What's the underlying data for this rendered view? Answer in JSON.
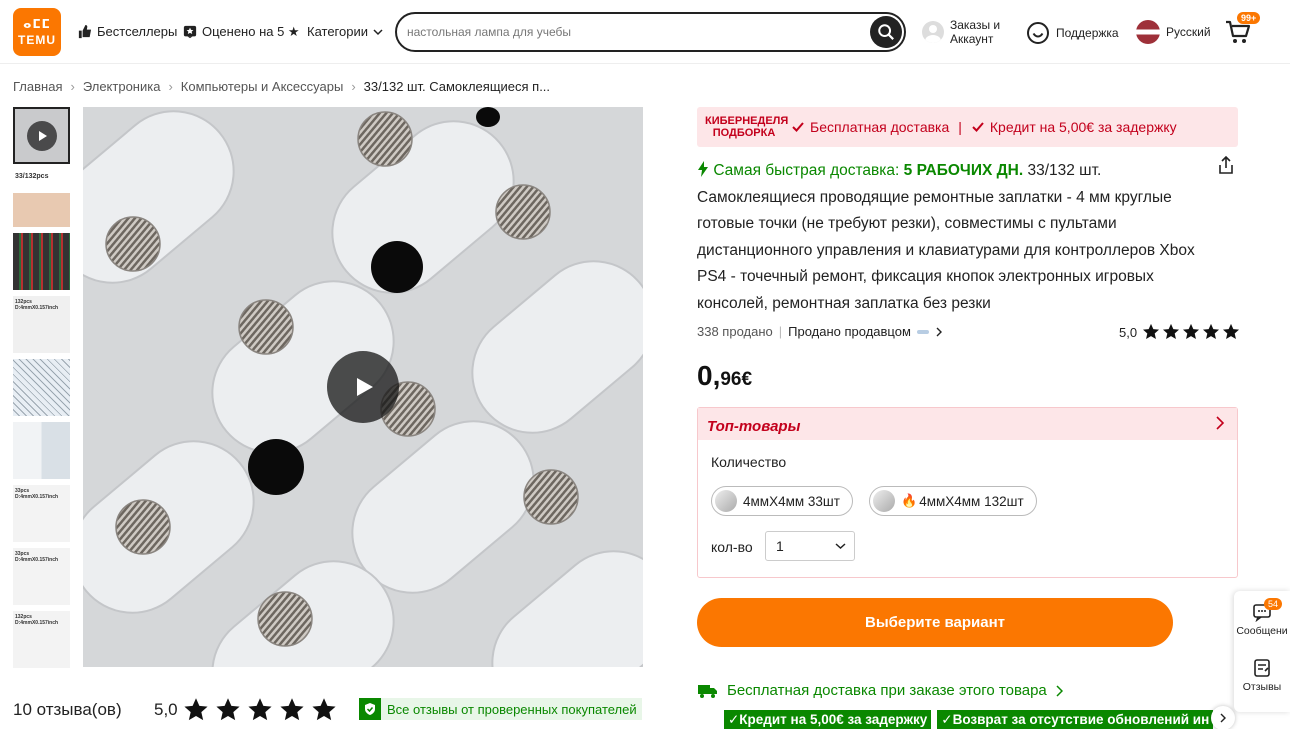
{
  "header": {
    "logo_top": "ⴰⵎⵎ",
    "logo_text": "TEMU",
    "bestsellers": "Бестселлеры",
    "rated5": "Оценено на 5 ★",
    "categories": "Категории",
    "search_placeholder": "настольная лампа для учебы",
    "account_line1": "Заказы и",
    "account_line2": "Аккаунт",
    "support": "Поддержка",
    "language": "Русский",
    "cart_count": "99+"
  },
  "breadcrumb": [
    "Главная",
    "Электроника",
    "Компьютеры и Аксессуары",
    "33/132 шт. Самоклеящиеся п..."
  ],
  "thumbnails": [
    {
      "label": ""
    },
    {
      "label": "33/132pcs"
    },
    {
      "label": ""
    },
    {
      "label": "132pcs D:4mmX0.157inch"
    },
    {
      "label": ""
    },
    {
      "label": ""
    },
    {
      "label": "33pcs D:4mmX0.157inch"
    },
    {
      "label": "33pcs D:4mmX0.157inch"
    },
    {
      "label": "132pcs D:4mmX0.157inch"
    }
  ],
  "promo": {
    "tag": "КИБЕРНЕДЕЛЯ ПОДБОРКА",
    "free_shipping": "Бесплатная доставка",
    "credit": "Кредит на 5,00€ за задержку"
  },
  "product": {
    "fast_prefix": "Самая быстрая доставка:",
    "fast_days": "5 РАБОЧИХ ДН.",
    "title": "33/132 шт. Самоклеящиеся проводящие ремонтные заплатки - 4 мм круглые готовые точки (не требуют резки), совместимы с пультами дистанционного управления и клавиатурами для контроллеров Xbox PS4 - точечный ремонт, фиксация кнопок электронных игровых консолей, ремонтная заплатка без резки",
    "sold": "338 продано",
    "seller": "Продано продавцом",
    "rating": "5,0",
    "price_int": "0,",
    "price_frac": "96€"
  },
  "options": {
    "top_label": "Топ-товары",
    "quantity_label": "Количество",
    "variants": [
      "4ммX4мм 33шт",
      "4ммX4мм 132шт"
    ],
    "kolvo_label": "кол-во",
    "kolvo_value": "1"
  },
  "cta": "Выберите вариант",
  "shipping": {
    "free": "Бесплатная доставка при заказе этого товара",
    "tag1": "✓Кредит на 5,00€ за задержку",
    "tag2": "✓Возврат за отсутствие обновлений ин"
  },
  "side": {
    "messages_count": "54",
    "messages": "Сообщени",
    "reviews": "Отзывы"
  },
  "reviews": {
    "count": "10 отзыва(ов)",
    "score": "5,0",
    "verified": "Все отзывы от проверенных покупателей"
  },
  "colors": {
    "accent": "#fb7701",
    "promo_red": "#c3001c",
    "green": "#0a8800"
  }
}
